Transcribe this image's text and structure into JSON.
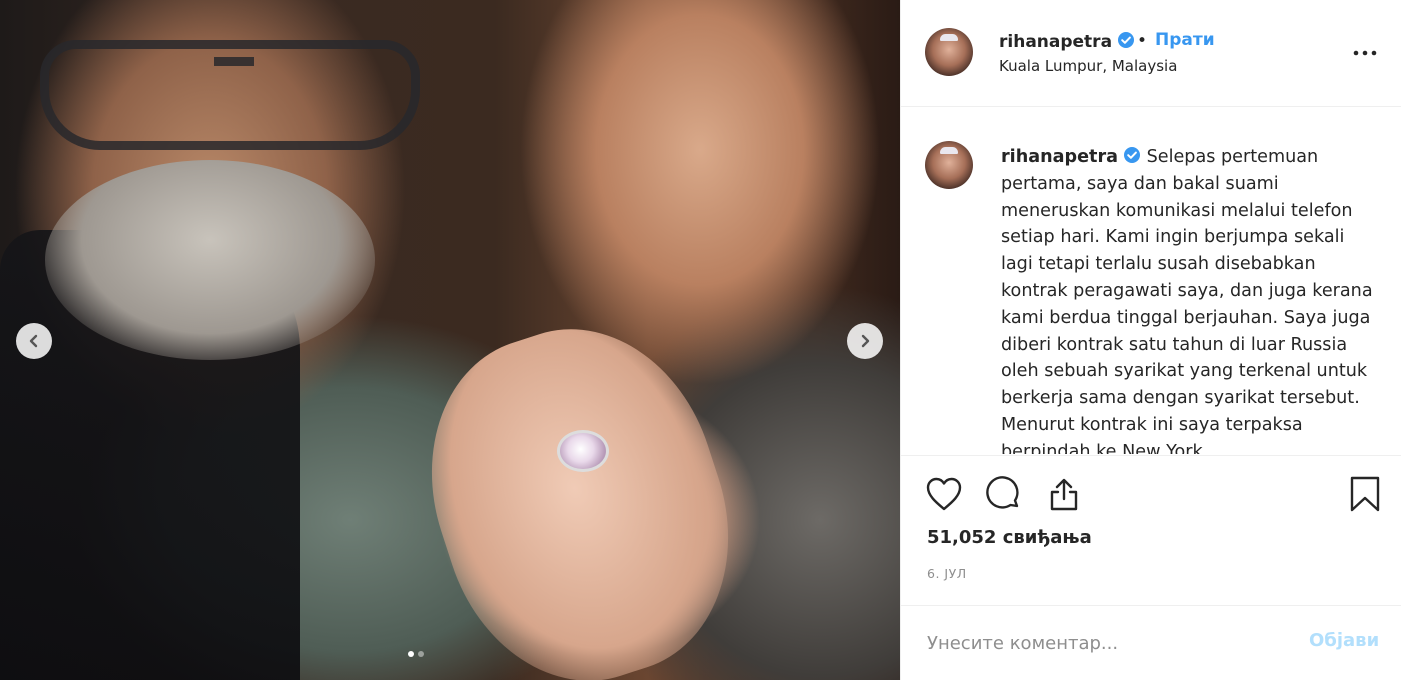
{
  "post": {
    "username": "rihanapetra",
    "follow_label": "Прати",
    "separator": "•",
    "location": "Kuala Lumpur, Malaysia",
    "caption": "Selepas pertemuan pertama, saya dan bakal suami meneruskan komunikasi melalui telefon setiap hari. Kami ingin berjumpa sekali lagi tetapi terlalu susah disebabkan kontrak peragawati saya, dan juga kerana kami berdua tinggal berjauhan. Saya juga diberi kontrak satu tahun di luar Russia oleh sebuah syarikat yang terkenal untuk berkerja sama dengan syarikat tersebut. Menurut kontrak ini saya terpaksa berpindah ke New York",
    "likes": "51,052 свиђања",
    "date": "6. ЈУЛ",
    "comment_placeholder": "Унесите коментар...",
    "post_label": "Објави"
  },
  "carousel": {
    "slide_count": 2,
    "active_slide": 1
  },
  "icons": {
    "verified": "verified-badge-icon",
    "more": "more-options-icon",
    "like": "heart-icon",
    "comment": "comment-bubble-icon",
    "share": "share-icon",
    "save": "bookmark-icon",
    "prev": "chevron-left-icon",
    "next": "chevron-right-icon"
  },
  "colors": {
    "link": "#3897f0",
    "verified": "#3897f0",
    "post_disabled": "#b2dffc",
    "muted": "#8e8e8e"
  }
}
